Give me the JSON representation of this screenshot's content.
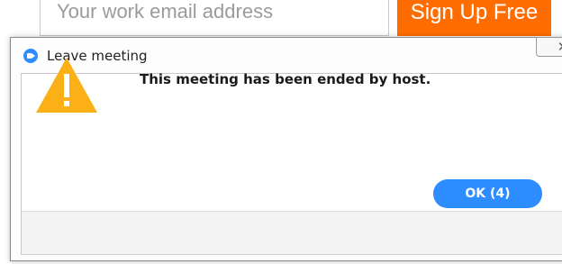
{
  "background": {
    "email_placeholder": "Your work email address",
    "signup_label": "Sign Up Free"
  },
  "dialog": {
    "title": "Leave meeting",
    "close_symbol": "✕",
    "message": "This meeting has been ended by host.",
    "ok_label": "OK (4)"
  },
  "colors": {
    "accent": "#2d8cff",
    "warning": "#fcb017",
    "signup": "#ff6d00"
  },
  "icons": {
    "app": "zoom-video-icon",
    "warning": "warning-triangle-icon",
    "close": "close-icon"
  }
}
